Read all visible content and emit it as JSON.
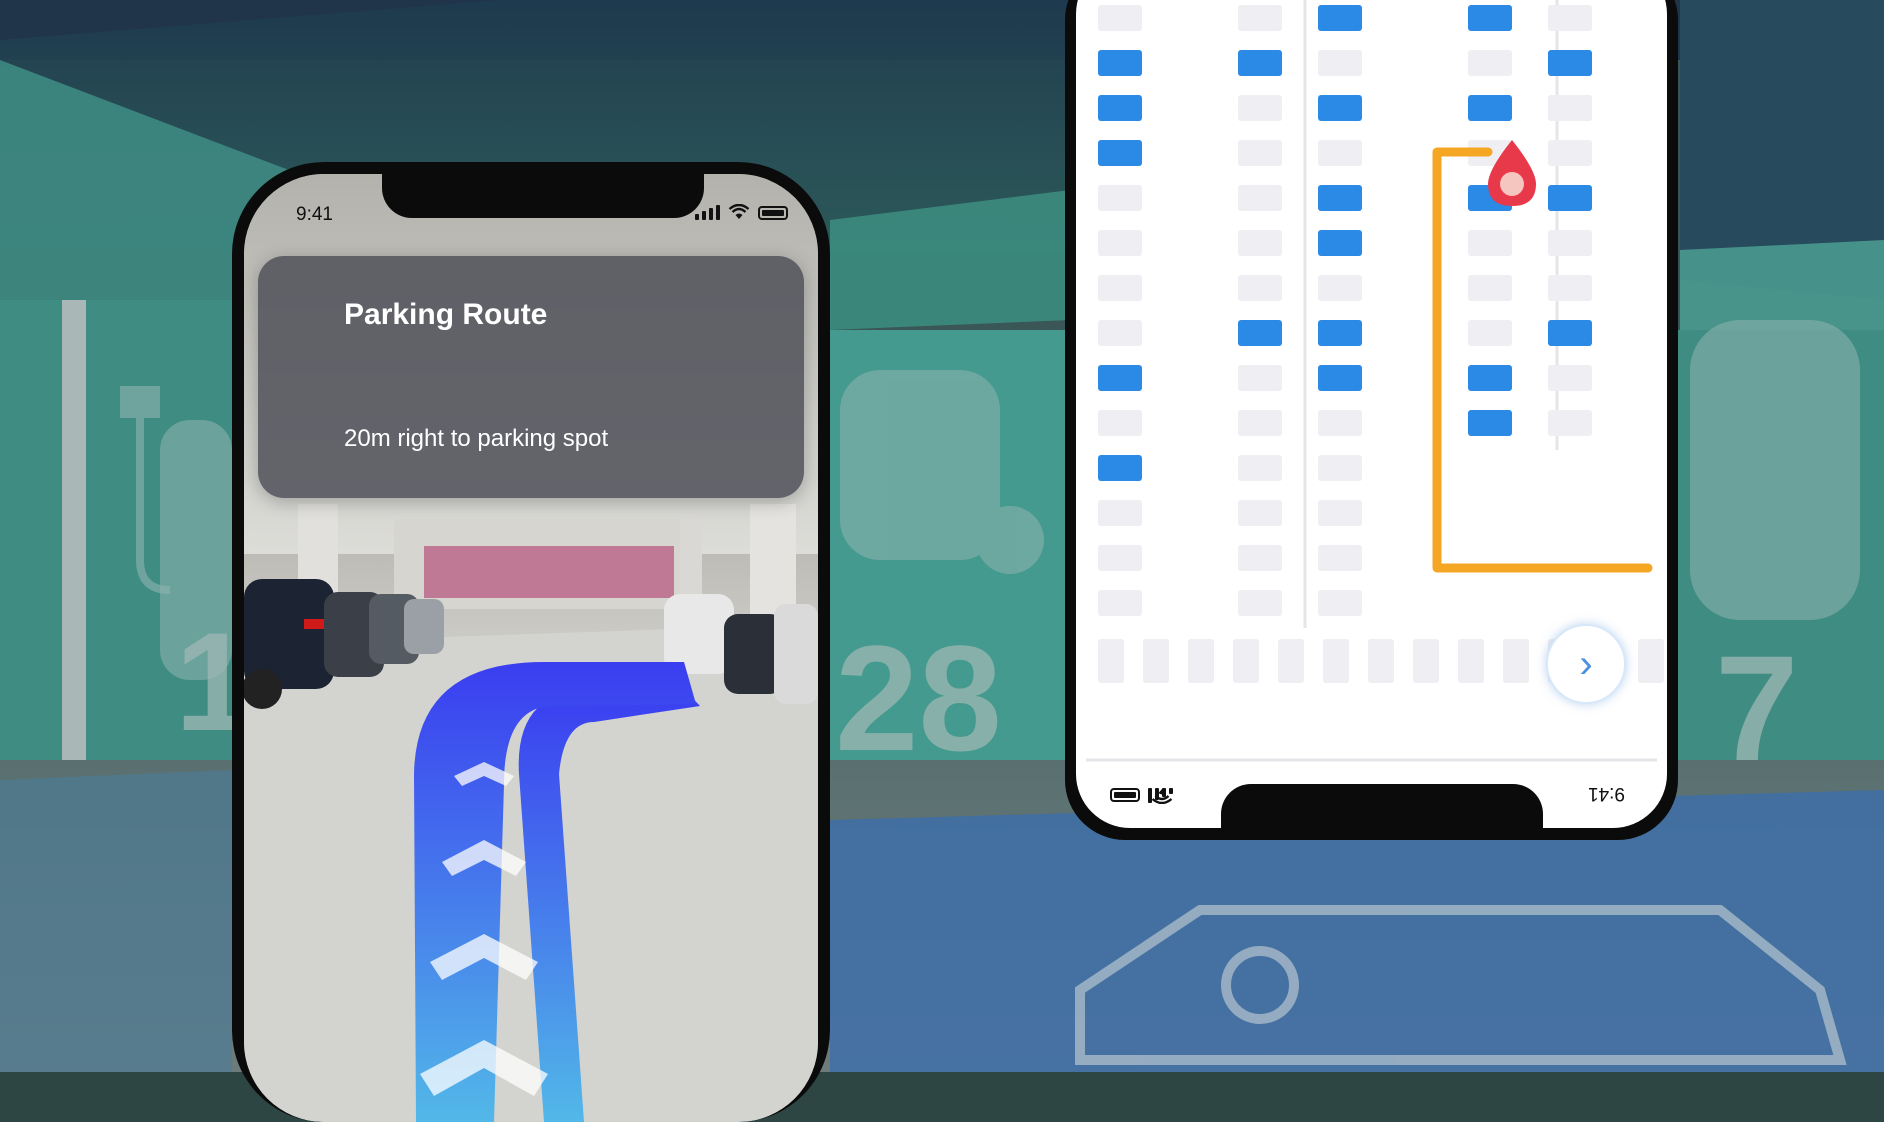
{
  "ar_phone": {
    "status_time": "9:41",
    "card_title": "Parking Route",
    "card_subtitle": "20m right to parking spot"
  },
  "map_phone": {
    "status_time": "9:41",
    "next_label": "›"
  },
  "background": {
    "spot_numbers": [
      "1",
      "28",
      "7"
    ]
  },
  "colors": {
    "route_orange": "#f5a623",
    "spot_blue": "#2b8ae6",
    "spot_empty": "#eeeef3",
    "pin_red": "#e8394a",
    "ar_path_top": "#3a3df0",
    "ar_path_bottom": "#52b8e8"
  }
}
